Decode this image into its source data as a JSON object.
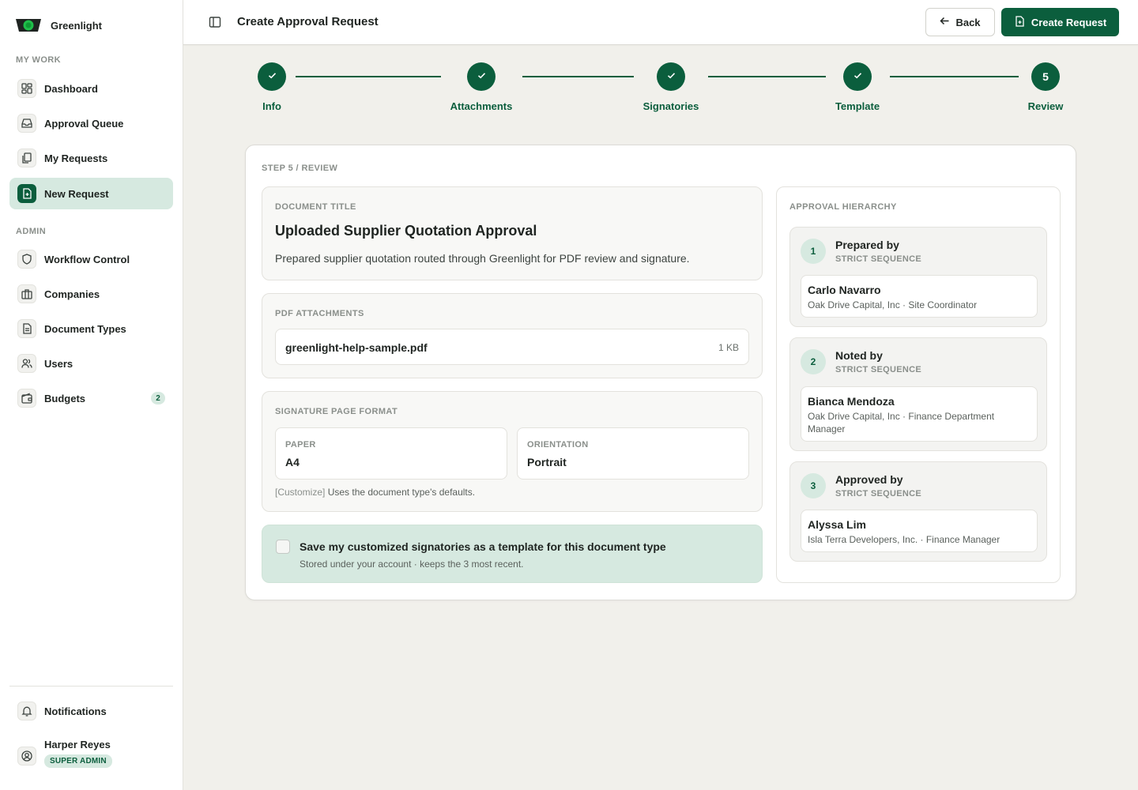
{
  "app": {
    "name": "Greenlight"
  },
  "sidebar": {
    "sections": {
      "my_work": "MY WORK",
      "admin": "ADMIN"
    },
    "items": [
      {
        "label": "Dashboard",
        "icon": "dashboard-icon"
      },
      {
        "label": "Approval Queue",
        "icon": "inbox-icon"
      },
      {
        "label": "My Requests",
        "icon": "documents-icon"
      },
      {
        "label": "New Request",
        "icon": "file-plus-icon",
        "active": true
      },
      {
        "label": "Workflow Control",
        "icon": "shield-icon"
      },
      {
        "label": "Companies",
        "icon": "building-icon"
      },
      {
        "label": "Document Types",
        "icon": "file-text-icon"
      },
      {
        "label": "Users",
        "icon": "users-icon"
      },
      {
        "label": "Budgets",
        "icon": "wallet-icon",
        "badge": "2"
      }
    ],
    "notifications": {
      "label": "Notifications",
      "icon": "bell-icon"
    },
    "user": {
      "name": "Harper Reyes",
      "role": "SUPER ADMIN"
    }
  },
  "header": {
    "title": "Create Approval Request",
    "back_label": "Back",
    "create_label": "Create Request"
  },
  "stepper": {
    "steps": [
      {
        "label": "Info",
        "status": "complete"
      },
      {
        "label": "Attachments",
        "status": "complete"
      },
      {
        "label": "Signatories",
        "status": "complete"
      },
      {
        "label": "Template",
        "status": "complete"
      },
      {
        "label": "Review",
        "status": "current",
        "number": "5"
      }
    ]
  },
  "review": {
    "crumb": "STEP 5 / REVIEW",
    "document": {
      "label": "DOCUMENT TITLE",
      "title": "Uploaded Supplier Quotation Approval",
      "description": "Prepared supplier quotation routed through Greenlight for PDF review and signature."
    },
    "attachments": {
      "label": "PDF ATTACHMENTS",
      "files": [
        {
          "name": "greenlight-help-sample.pdf",
          "size": "1 KB"
        }
      ]
    },
    "format": {
      "label": "SIGNATURE PAGE FORMAT",
      "paper_label": "PAPER",
      "paper": "A4",
      "orientation_label": "ORIENTATION",
      "orientation": "Portrait",
      "customize": "[Customize]",
      "note": " Uses the document type's defaults."
    },
    "save_template": {
      "checked": false,
      "title": "Save my customized signatories as a template for this document type",
      "subtitle": "Stored under your account · keeps the 3 most recent."
    }
  },
  "hierarchy": {
    "label": "APPROVAL HIERARCHY",
    "tiers": [
      {
        "number": "1",
        "title": "Prepared by",
        "sequence": "STRICT SEQUENCE",
        "signer": "Carlo Navarro",
        "org": "Oak Drive Capital, Inc · Site Coordinator"
      },
      {
        "number": "2",
        "title": "Noted by",
        "sequence": "STRICT SEQUENCE",
        "signer": "Bianca Mendoza",
        "org": "Oak Drive Capital, Inc · Finance Department Manager"
      },
      {
        "number": "3",
        "title": "Approved by",
        "sequence": "STRICT SEQUENCE",
        "signer": "Alyssa Lim",
        "org": "Isla Terra Developers, Inc. · Finance Manager"
      }
    ]
  },
  "colors": {
    "brand": "#0b5e3d",
    "brand_soft": "#d6e9e0",
    "background": "#f1f0eb"
  }
}
